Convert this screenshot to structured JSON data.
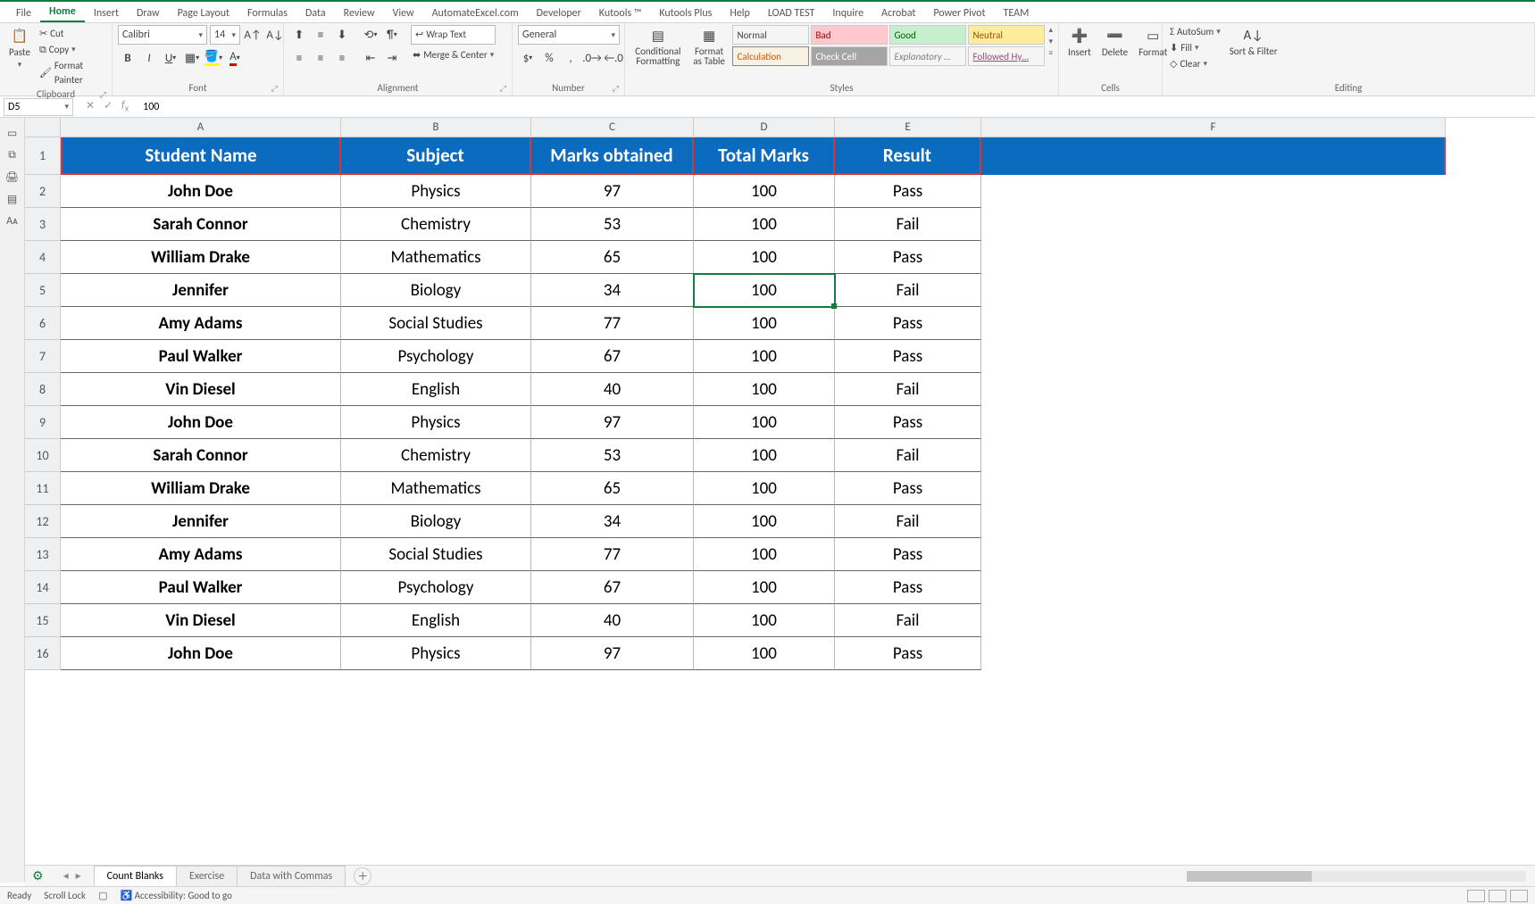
{
  "tabs": {
    "file": "File",
    "home": "Home",
    "insert": "Insert",
    "draw": "Draw",
    "page_layout": "Page Layout",
    "formulas": "Formulas",
    "data": "Data",
    "review": "Review",
    "view": "View",
    "automate": "AutomateExcel.com",
    "developer": "Developer",
    "kutools": "Kutools ™",
    "kutools_plus": "Kutools Plus",
    "help": "Help",
    "load_test": "LOAD TEST",
    "inquire": "Inquire",
    "acrobat": "Acrobat",
    "power_pivot": "Power Pivot",
    "team": "TEAM"
  },
  "ribbon": {
    "clipboard": {
      "label": "Clipboard",
      "paste": "Paste",
      "cut": "Cut",
      "copy": "Copy",
      "format_painter": "Format Painter"
    },
    "font": {
      "label": "Font",
      "name": "Calibri",
      "size": "14"
    },
    "alignment": {
      "label": "Alignment",
      "wrap": "Wrap Text",
      "merge": "Merge & Center"
    },
    "number": {
      "label": "Number",
      "format": "General"
    },
    "styles": {
      "label": "Styles",
      "cond": "Conditional Formatting",
      "table": "Format as Table",
      "normal": "Normal",
      "bad": "Bad",
      "good": "Good",
      "neutral": "Neutral",
      "calculation": "Calculation",
      "check": "Check Cell",
      "explanatory": "Explanatory …",
      "followed": "Followed Hy…"
    },
    "cells": {
      "label": "Cells",
      "insert": "Insert",
      "delete": "Delete",
      "format": "Format"
    },
    "editing": {
      "label": "Editing",
      "autosum": "AutoSum",
      "fill": "Fill",
      "clear": "Clear",
      "sort": "Sort & Filter"
    }
  },
  "namebox": "D5",
  "formula_value": "100",
  "columns": [
    "A",
    "B",
    "C",
    "D",
    "E",
    "F"
  ],
  "col_widths": [
    "cw-A",
    "cw-B",
    "cw-C",
    "cw-D",
    "cw-E",
    "cw-F"
  ],
  "header_row": [
    "Student Name",
    "Subject",
    "Marks obtained",
    "Total Marks",
    "Result"
  ],
  "data_rows": [
    [
      "John Doe",
      "Physics",
      "97",
      "100",
      "Pass"
    ],
    [
      "Sarah Connor",
      "Chemistry",
      "53",
      "100",
      "Fail"
    ],
    [
      "William Drake",
      "Mathematics",
      "65",
      "100",
      "Pass"
    ],
    [
      "Jennifer",
      "Biology",
      "34",
      "100",
      "Fail"
    ],
    [
      "Amy Adams",
      "Social Studies",
      "77",
      "100",
      "Pass"
    ],
    [
      "Paul Walker",
      "Psychology",
      "67",
      "100",
      "Pass"
    ],
    [
      "Vin Diesel",
      "English",
      "40",
      "100",
      "Fail"
    ],
    [
      "John Doe",
      "Physics",
      "97",
      "100",
      "Pass"
    ],
    [
      "Sarah Connor",
      "Chemistry",
      "53",
      "100",
      "Fail"
    ],
    [
      "William Drake",
      "Mathematics",
      "65",
      "100",
      "Pass"
    ],
    [
      "Jennifer",
      "Biology",
      "34",
      "100",
      "Fail"
    ],
    [
      "Amy Adams",
      "Social Studies",
      "77",
      "100",
      "Pass"
    ],
    [
      "Paul Walker",
      "Psychology",
      "67",
      "100",
      "Pass"
    ],
    [
      "Vin Diesel",
      "English",
      "40",
      "100",
      "Fail"
    ],
    [
      "John Doe",
      "Physics",
      "97",
      "100",
      "Pass"
    ]
  ],
  "selected": {
    "row": 4,
    "col": 3
  },
  "sheet_tabs": {
    "active": "Count Blanks",
    "t2": "Exercise",
    "t3": "Data with Commas"
  },
  "status": {
    "ready": "Ready",
    "scroll": "Scroll Lock",
    "access": "Accessibility: Good to go"
  }
}
